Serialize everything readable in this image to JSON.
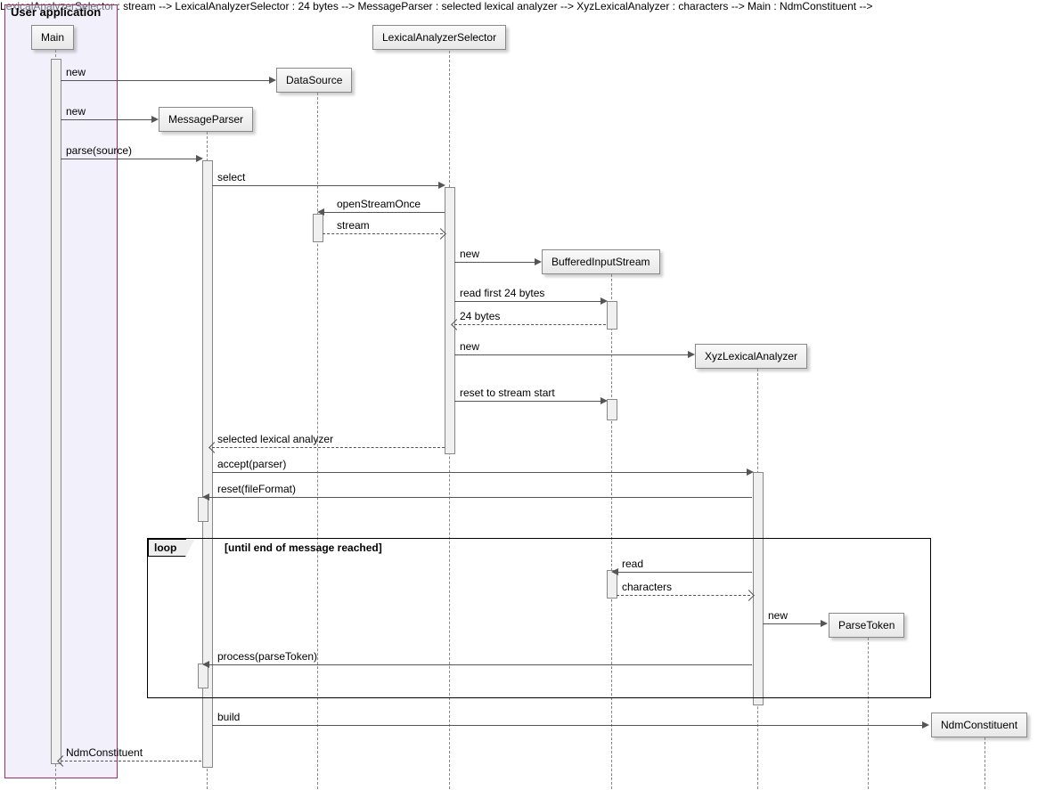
{
  "group": {
    "label": "User application"
  },
  "participants": {
    "main": "Main",
    "messageParser": "MessageParser",
    "dataSource": "DataSource",
    "lexicalSelector": "LexicalAnalyzerSelector",
    "bufferedStream": "BufferedInputStream",
    "xyzLexer": "XyzLexicalAnalyzer",
    "parseToken": "ParseToken",
    "ndmConstituent": "NdmConstituent"
  },
  "messages": {
    "new1": "new",
    "new2": "new",
    "parseSource": "parse(source)",
    "select": "select",
    "openStreamOnce": "openStreamOnce",
    "stream": "stream",
    "new3": "new",
    "readFirst24": "read first 24 bytes",
    "bytes24": "24 bytes",
    "new4": "new",
    "resetStart": "reset to stream start",
    "selectedLexer": "selected lexical analyzer",
    "acceptParser": "accept(parser)",
    "resetFileFormat": "reset(fileFormat)",
    "read": "read",
    "characters": "characters",
    "new5": "new",
    "processParseToken": "process(parseToken)",
    "build": "build",
    "ndmReturn": "NdmConstituent"
  },
  "fragment": {
    "loopLabel": "loop",
    "loopCondition": "[until end of message reached]"
  }
}
